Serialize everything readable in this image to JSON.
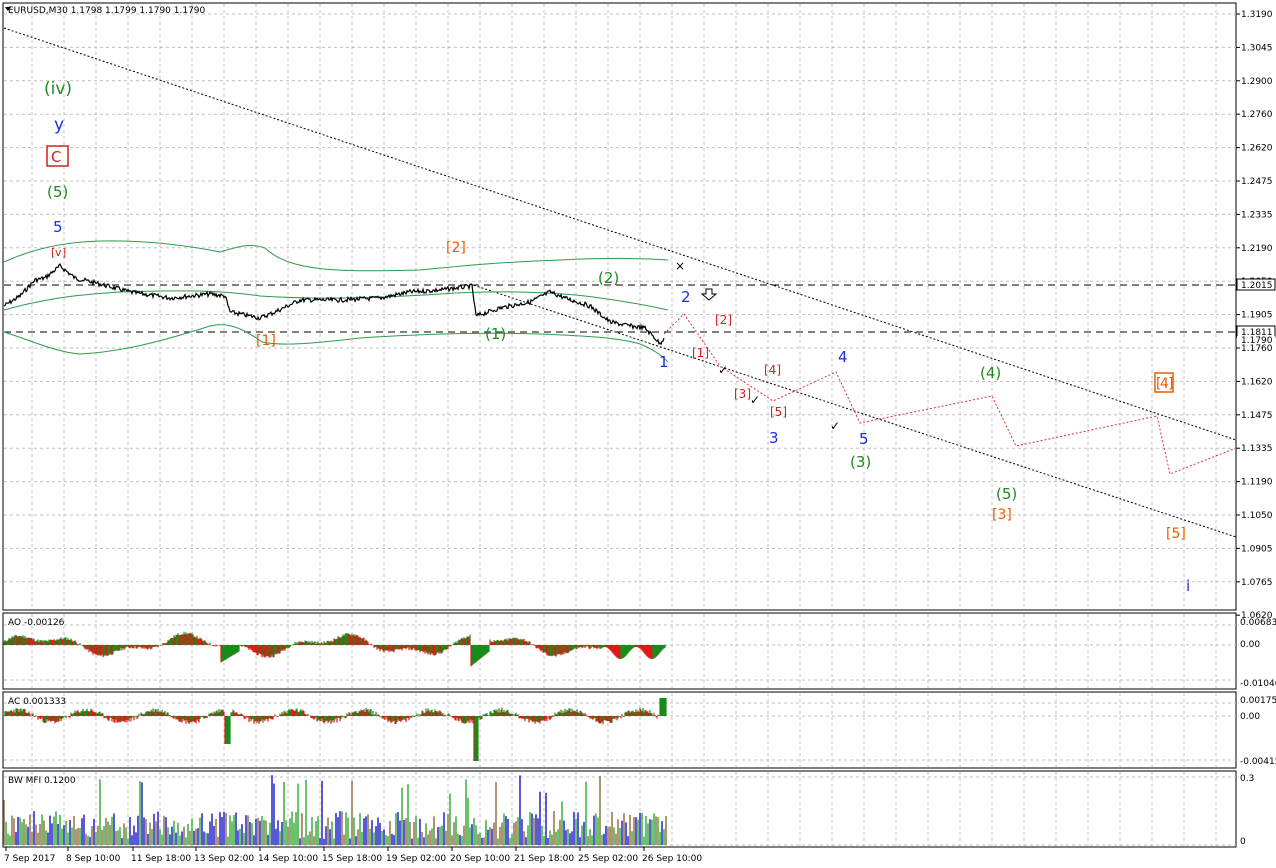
{
  "window": {
    "symbol_header": "EURUSD,M30  1.1798 1.1799 1.1790 1.1790"
  },
  "colors": {
    "background": "#ffffff",
    "grid": "#c0c0c0",
    "price": "#000000",
    "envelope": "#2e9b4f",
    "projection": "#e0303a",
    "bull": "#1a8a1a",
    "bear": "#e01818",
    "mfi_green": "#2ea82e",
    "mfi_blue": "#1414c8",
    "mfi_brown": "#8b6a3a",
    "wave_green": "#1f8a1f",
    "wave_blue": "#1c2fd6",
    "wave_red": "#d41f1f",
    "wave_orange": "#ee5a00"
  },
  "main_axis": {
    "ticks": [
      "1.3190",
      "1.3045",
      "1.2900",
      "1.2760",
      "1.2620",
      "1.2475",
      "1.2335",
      "1.2190",
      "1.2050",
      "1.1905",
      "1.1760",
      "1.1620",
      "1.1475",
      "1.1335",
      "1.1190",
      "1.1050",
      "1.0905",
      "1.0765",
      "1.0620"
    ],
    "price_tag_1": "1.2015",
    "price_tag_2": "1.1811",
    "price_tag_3": "1.1790"
  },
  "time_axis": {
    "labels": [
      "7 Sep 2017",
      "8 Sep 10:00",
      "11 Sep 18:00",
      "13 Sep 02:00",
      "14 Sep 10:00",
      "15 Sep 18:00",
      "19 Sep 02:00",
      "20 Sep 10:00",
      "21 Sep 18:00",
      "25 Sep 02:00",
      "26 Sep 10:00"
    ]
  },
  "wave_labels": {
    "iv_green": "(iv)",
    "y_blue": "y",
    "c_red": "C",
    "five_green": "(5)",
    "five_blue": "5",
    "v_red": "v",
    "two_orange": "[2]",
    "one_orange": "[1]",
    "two_green": "(2)",
    "one_green": "(1)",
    "one_blue": "1",
    "two_blue": "2",
    "two_red": "[2]",
    "one_red": "[1]",
    "four_red": "[4]",
    "three_red": "[3]",
    "five_red": "[5]",
    "three_blue": "3",
    "four_blue": "4",
    "five_blue_b": "5",
    "three_green": "(3)",
    "four_green": "(4)",
    "five_green_b": "(5)",
    "three_orange": "[3]",
    "four_orange": "4",
    "five_orange": "[5]",
    "i_blue": "i"
  },
  "indicators": {
    "ao": {
      "header": "AO -0.00126",
      "ticks": [
        "0.00683",
        "0.00",
        "-0.01046"
      ]
    },
    "ac": {
      "header": "AC 0.001333",
      "ticks": [
        "0.00175",
        "0.00",
        "-0.00415"
      ]
    },
    "mfi": {
      "header": "BW MFI 0.1200",
      "ticks": [
        "0.3",
        "0"
      ]
    }
  },
  "chart_data": {
    "type": "line",
    "title": "EURUSD,M30",
    "x": [
      "7 Sep 2017",
      "8 Sep 10:00",
      "11 Sep 18:00",
      "13 Sep 02:00",
      "14 Sep 10:00",
      "15 Sep 18:00",
      "19 Sep 02:00",
      "20 Sep 10:00",
      "21 Sep 18:00",
      "25 Sep 02:00",
      "26 Sep 10:00"
    ],
    "series": [
      {
        "name": "EURUSD",
        "values": [
          1.1985,
          1.201,
          1.1985,
          1.199,
          1.1945,
          1.1985,
          1.2,
          1.1935,
          1.197,
          1.19,
          1.179
        ]
      }
    ],
    "ylim": [
      1.062,
      1.319
    ],
    "grid": true,
    "horizontal_levels": [
      1.2015,
      1.1811
    ]
  }
}
